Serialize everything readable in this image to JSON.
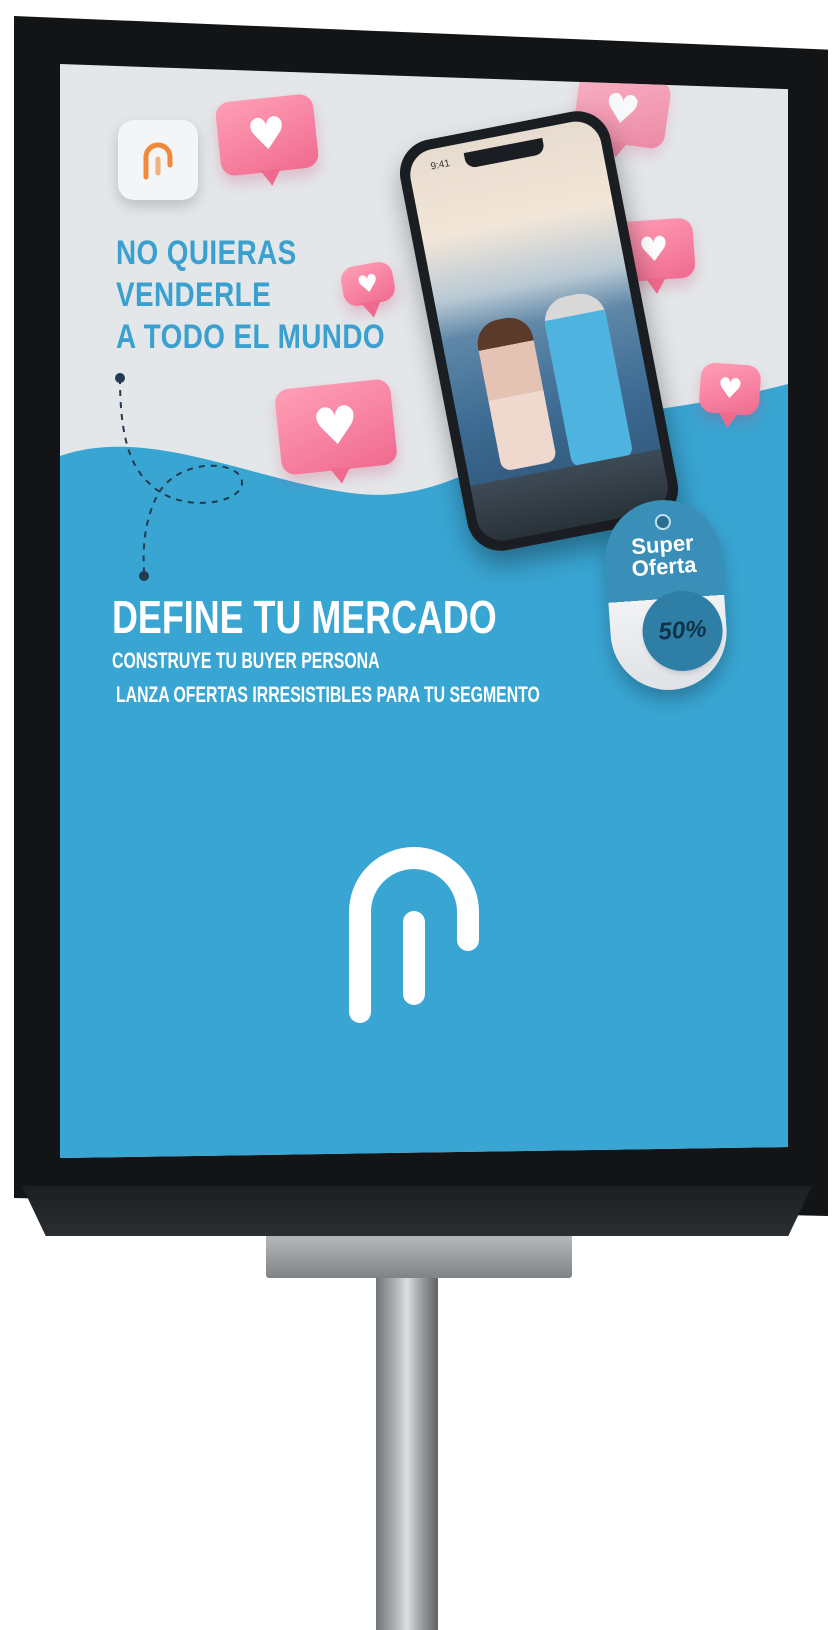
{
  "poster": {
    "headline": [
      "NO QUIERAS",
      "VENDERLE",
      "A TODO EL MUNDO"
    ],
    "tag": {
      "line1": "Super",
      "line2": "Oferta",
      "discount": "50%"
    },
    "title": "DEFINE TU MERCADO",
    "subtitle1": "CONSTRUYE TU BUYER PERSONA",
    "subtitle2": "LANZA OFERTAS IRRESISTIBLES PARA TU SEGMENTO",
    "phone_status": "9:41",
    "heart_symbol": "♥"
  },
  "colors": {
    "brand_blue": "#39a5d3",
    "headline_blue": "#3aa0cf",
    "heart_pink": "#f06a8f",
    "logo_orange": "#f08a3a"
  },
  "icons": [
    "app-logo-icon",
    "heart-icon",
    "brand-logo-icon"
  ]
}
